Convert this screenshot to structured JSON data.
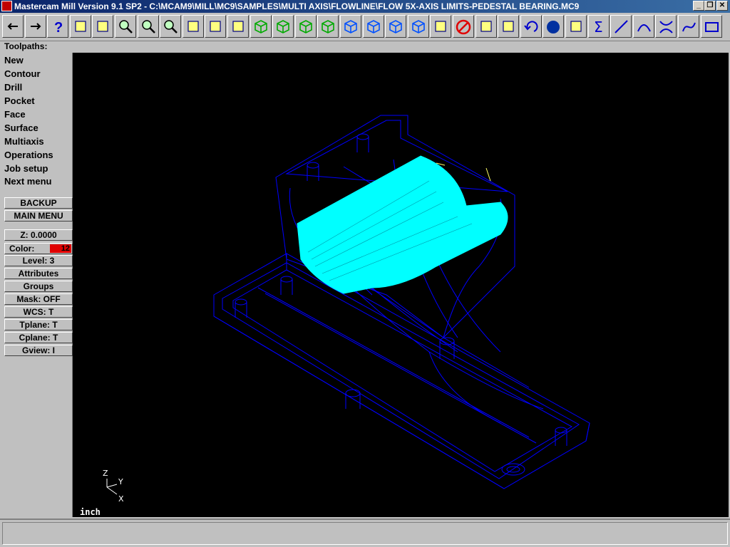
{
  "window": {
    "title": "Mastercam Mill Version 9.1 SP2 - C:\\MCAM9\\MILL\\MC9\\SAMPLES\\MULTI AXIS\\FLOWLINE\\FLOW 5X-AXIS LIMITS-PEDESTAL BEARING.MC9",
    "minimize_glyph": "_",
    "maximize_glyph": "❐",
    "close_glyph": "✕"
  },
  "toolbar": {
    "icons": [
      "back-arrow",
      "forward-arrow",
      "help",
      "file-cabinet",
      "analyze",
      "zoom",
      "zoom-window",
      "zoom-fit",
      "pan",
      "select",
      "repaint",
      "view-iso",
      "view-top",
      "view-front",
      "view-side",
      "cube-1",
      "cube-2",
      "cube-3",
      "cube-4",
      "pencil",
      "no-delete",
      "translate",
      "multi-xform",
      "undo",
      "sphere",
      "boxes",
      "sum",
      "line",
      "arc",
      "trim",
      "spline",
      "rectangle"
    ]
  },
  "sidebar": {
    "heading": "Toolpaths:",
    "menu": [
      {
        "label": "New"
      },
      {
        "label": "Contour"
      },
      {
        "label": "Drill"
      },
      {
        "label": "Pocket"
      },
      {
        "label": "Face"
      },
      {
        "label": "Surface"
      },
      {
        "label": "Multiaxis"
      },
      {
        "label": "Operations"
      },
      {
        "label": "Job setup"
      },
      {
        "label": "Next menu"
      }
    ],
    "backup": "BACKUP",
    "main_menu": "MAIN MENU",
    "z": "Z:  0.0000",
    "color_label": "Color:",
    "color_value": "12",
    "level": "Level:  3",
    "attributes": "Attributes",
    "groups": "Groups",
    "mask": "Mask:  OFF",
    "wcs": "WCS:   T",
    "tplane": "Tplane:  T",
    "cplane": "Cplane:  T",
    "gview": "Gview:   I"
  },
  "viewport": {
    "units": "inch",
    "axis_z": "Z",
    "axis_y": "Y",
    "axis_x": "X",
    "wire_color": "#0000ff",
    "toolpath_color": "#00ffff"
  }
}
